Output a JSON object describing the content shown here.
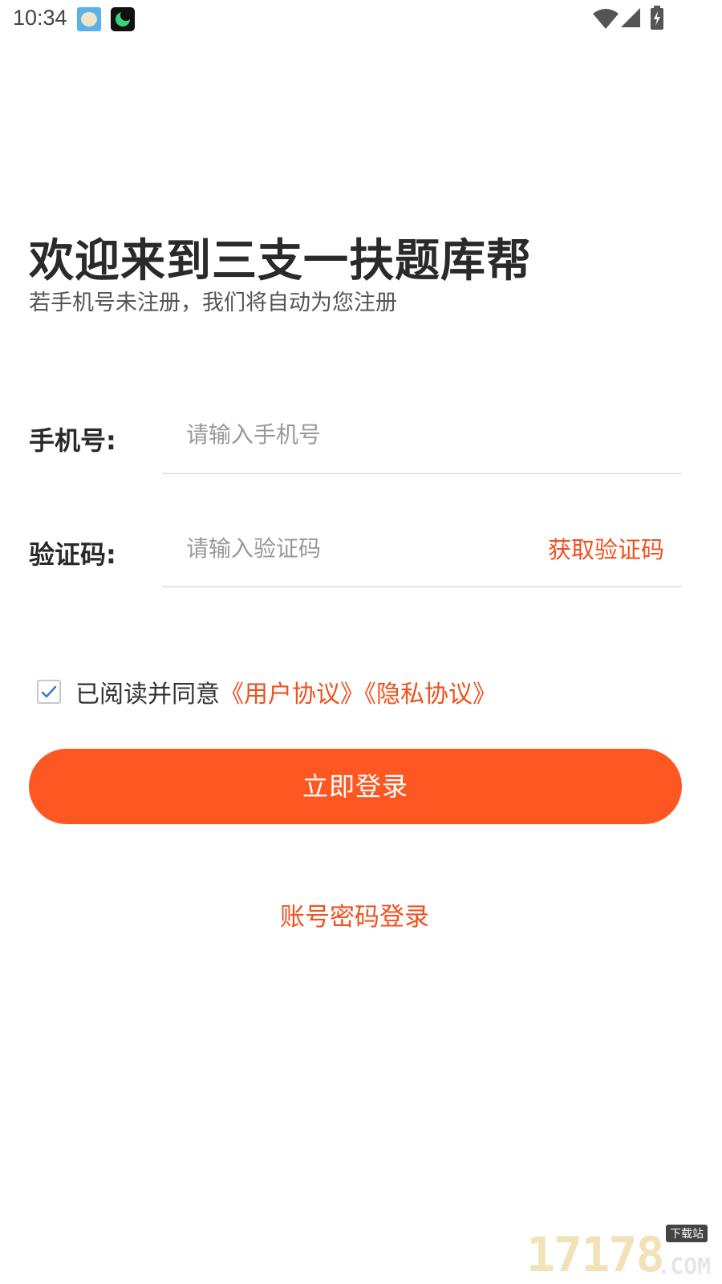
{
  "status_bar": {
    "time": "10:34",
    "icons": [
      "app-icon-face",
      "app-icon-moon",
      "wifi-icon",
      "signal-icon",
      "battery-charging-icon"
    ]
  },
  "header": {
    "title": "欢迎来到三支一扶题库帮",
    "subtitle": "若手机号未注册，我们将自动为您注册"
  },
  "form": {
    "phone": {
      "label": "手机号:",
      "placeholder": "请输入手机号",
      "value": ""
    },
    "code": {
      "label": "验证码:",
      "placeholder": "请输入验证码",
      "value": "",
      "get_code_label": "获取验证码"
    }
  },
  "agreement": {
    "checked": true,
    "prefix": "已阅读并同意",
    "user_agreement": "《用户协议》",
    "privacy_agreement": "《隐私协议》"
  },
  "actions": {
    "login_label": "立即登录",
    "password_login_label": "账号密码登录"
  },
  "watermark": {
    "digits": "17178",
    "tag": "下载站",
    "suffix": ".COM"
  },
  "colors": {
    "accent": "#fe5722",
    "link": "#f0511e",
    "title": "#2a2a2a",
    "checkbox_tick": "#2f7de1"
  }
}
